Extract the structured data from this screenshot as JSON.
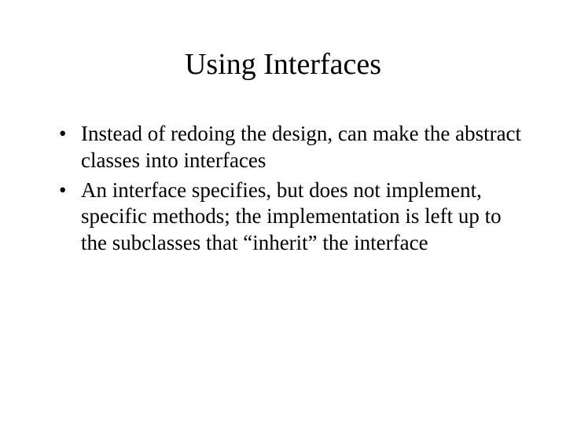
{
  "slide": {
    "title": "Using Interfaces",
    "bullets": [
      "Instead of redoing the design, can make the abstract classes into interfaces",
      "An interface specifies, but does not implement, specific methods; the implementation is left up to the subclasses that “inherit” the interface"
    ]
  }
}
